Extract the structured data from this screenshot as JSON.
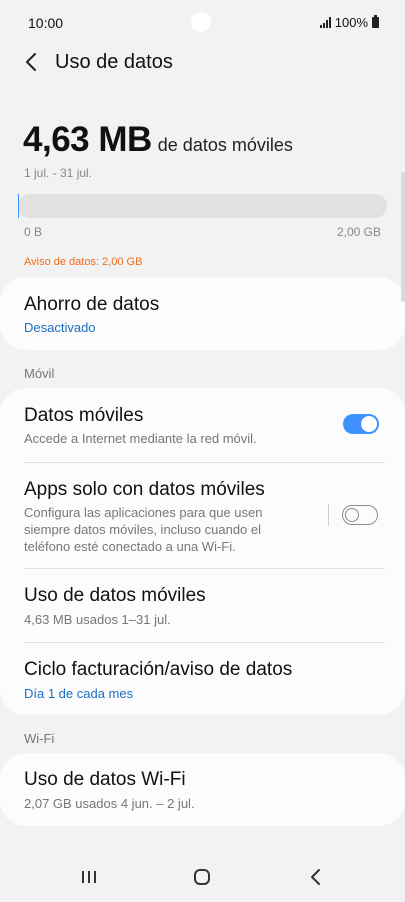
{
  "status_bar": {
    "time": "10:00",
    "battery": "100%"
  },
  "header": {
    "title": "Uso de datos"
  },
  "usage": {
    "amount": "4,63 MB",
    "unit_label": "de datos móviles",
    "period": "1 jul. - 31 jul.",
    "bar_fill_fraction": 0.0023,
    "bar_min": "0 B",
    "bar_max": "2,00 GB",
    "warning": "Aviso de datos: 2,00 GB"
  },
  "data_saver": {
    "title": "Ahorro de datos",
    "status": "Desactivado"
  },
  "mobile_section": {
    "label": "Móvil",
    "items": [
      {
        "title": "Datos móviles",
        "subtitle": "Accede a Internet mediante la red móvil.",
        "toggle": true
      },
      {
        "title": "Apps solo con datos móviles",
        "subtitle_lines": [
          "Configura las aplicaciones para que usen",
          "siempre datos móviles, incluso cuando el",
          "teléfono esté conectado a una Wi-Fi."
        ],
        "toggle": false
      },
      {
        "title": "Uso de datos móviles",
        "subtitle": "4,63 MB usados 1–31 jul."
      },
      {
        "title": "Ciclo facturación/aviso de datos",
        "subtitle": "Día 1 de cada mes"
      }
    ]
  },
  "wifi_section": {
    "label": "Wi-Fi",
    "items": [
      {
        "title": "Uso de datos Wi-Fi",
        "subtitle": "2,07 GB usados 4 jun. – 2 jul."
      }
    ]
  },
  "colors": {
    "accent": "#3e91ff",
    "warning": "#ef6c1e",
    "link": "#1a6fc4",
    "background": "#f2f2f2"
  },
  "icons": [
    "back-arrow-icon",
    "signal-icon",
    "battery-icon",
    "recent-apps-icon",
    "home-icon",
    "nav-back-icon"
  ]
}
